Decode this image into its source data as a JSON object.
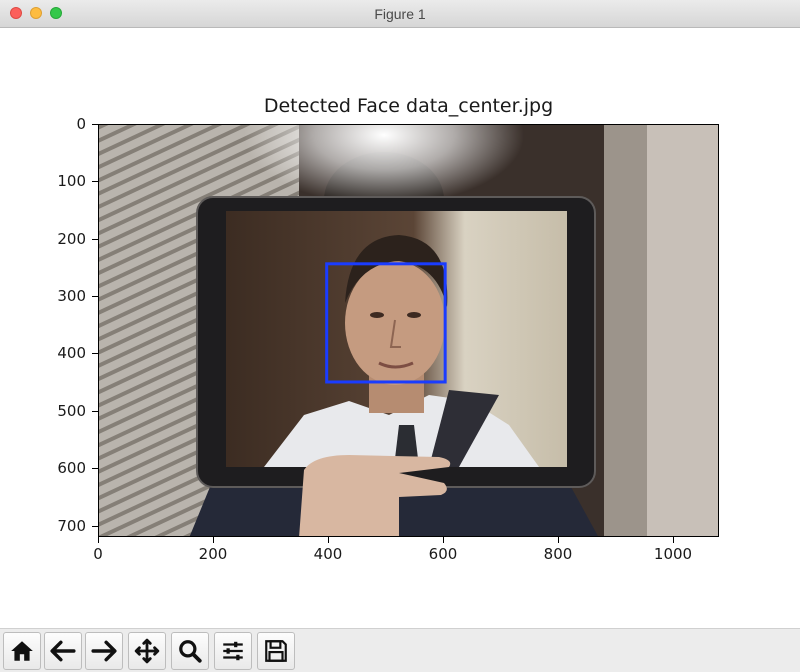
{
  "window": {
    "title": "Figure 1"
  },
  "figure": {
    "title": "Detected Face data_center.jpg",
    "image_size": {
      "width": 1080,
      "height": 720
    },
    "x_ticks": [
      "0",
      "200",
      "400",
      "600",
      "800",
      "1000"
    ],
    "y_ticks": [
      "0",
      "100",
      "200",
      "300",
      "400",
      "500",
      "600",
      "700"
    ],
    "face_box": {
      "x0": 396,
      "y0": 242,
      "x1": 602,
      "y1": 448,
      "color": "#1a3cff"
    }
  },
  "toolbar": {
    "buttons": [
      {
        "name": "home-button",
        "icon": "home-icon"
      },
      {
        "name": "back-button",
        "icon": "arrow-left-icon"
      },
      {
        "name": "forward-button",
        "icon": "arrow-right-icon"
      },
      {
        "name": "pan-button",
        "icon": "move-icon"
      },
      {
        "name": "zoom-button",
        "icon": "magnifier-icon"
      },
      {
        "name": "configure-subplots-button",
        "icon": "sliders-icon"
      },
      {
        "name": "save-button",
        "icon": "floppy-disk-icon"
      }
    ]
  }
}
